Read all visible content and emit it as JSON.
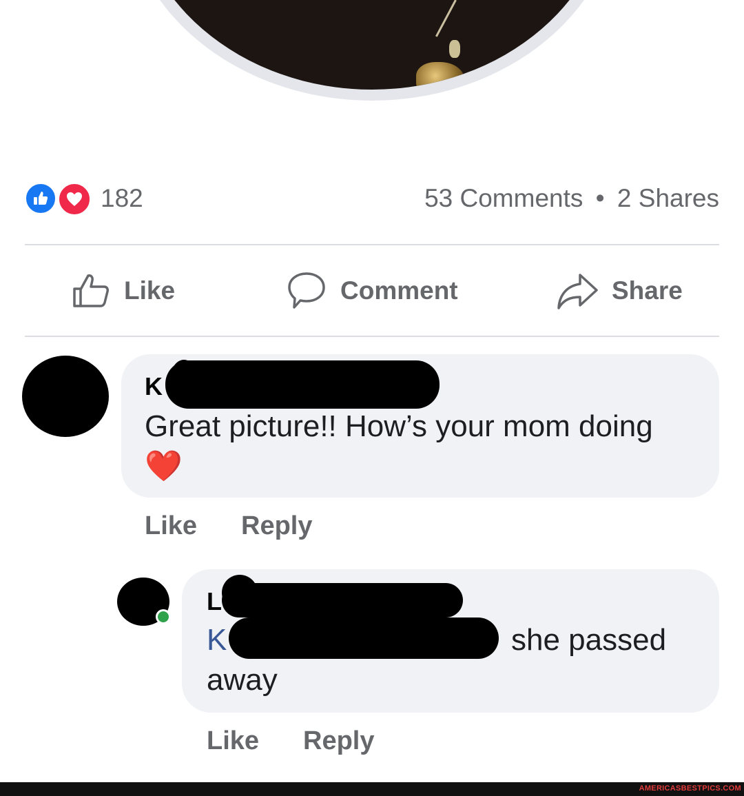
{
  "post": {
    "reaction_count": "182",
    "comments_count": "53 Comments",
    "separator": "•",
    "shares_count": "2 Shares",
    "reactions": [
      "like-icon",
      "love-icon"
    ]
  },
  "actions": {
    "like_label": "Like",
    "comment_label": "Comment",
    "share_label": "Share"
  },
  "comments": [
    {
      "author_visible": "K",
      "text": "Great picture!! How’s your mom doing",
      "emoji": "❤️",
      "like_label": "Like",
      "reply_label": "Reply"
    },
    {
      "author_visible": "L",
      "mention_visible": "K",
      "text_tail": "she passed",
      "text_line2": "away",
      "like_label": "Like",
      "reply_label": "Reply"
    }
  ],
  "footer": {
    "watermark": "AMERICASBESTPICS.COM"
  },
  "colors": {
    "like_blue": "#1877f2",
    "love_red": "#f02849",
    "muted_text": "#65676b",
    "bubble_bg": "#f0f2f5",
    "mention": "#385898",
    "online": "#31a24c"
  }
}
